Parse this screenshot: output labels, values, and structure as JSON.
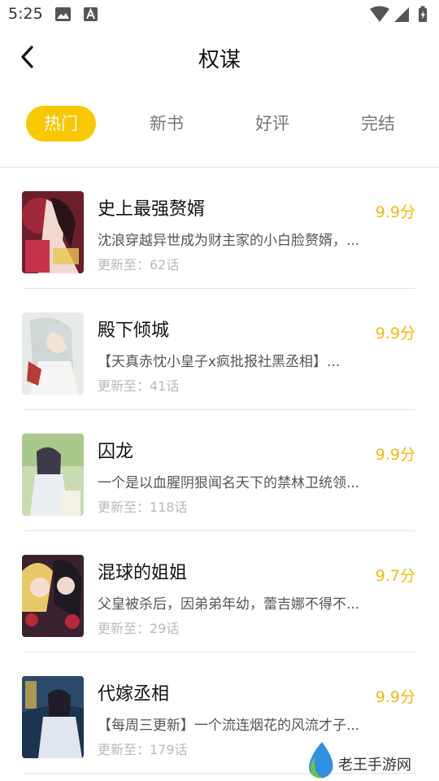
{
  "status_bar": {
    "time": "5:25",
    "left_icons": [
      "image-icon",
      "font-icon"
    ],
    "right_icons": [
      "wifi-icon",
      "signal-icon",
      "battery-icon"
    ]
  },
  "header": {
    "title": "权谋",
    "back_icon": "chevron-left-icon"
  },
  "tabs": [
    {
      "label": "热门",
      "active": true
    },
    {
      "label": "新书",
      "active": false
    },
    {
      "label": "好评",
      "active": false
    },
    {
      "label": "完结",
      "active": false
    }
  ],
  "colors": {
    "accent": "#f7c800",
    "score": "#f2b90f"
  },
  "books": [
    {
      "title": "史上最强赘婿",
      "score": "9.9分",
      "desc": "沈浪穿越异世成为财主家的小白脸赘婿，...",
      "update": "更新至：62话"
    },
    {
      "title": "殿下倾城",
      "score": "9.9分",
      "desc": "【天真赤忱小皇子x疯批报社黑丞相】...",
      "update": "更新至：41话"
    },
    {
      "title": "囚龙",
      "score": "9.9分",
      "desc": "一个是以血腥阴狠闻名天下的禁林卫统领...",
      "update": "更新至：118话"
    },
    {
      "title": "混球的姐姐",
      "score": "9.7分",
      "desc": "父皇被杀后，因弟弟年幼，蕾吉娜不得不...",
      "update": "更新至：29话"
    },
    {
      "title": "代嫁丞相",
      "score": "9.9分",
      "desc": "【每周三更新】一个流连烟花的风流才子...",
      "update": "更新至：179话"
    }
  ],
  "watermark": {
    "text": "老王手游网"
  }
}
